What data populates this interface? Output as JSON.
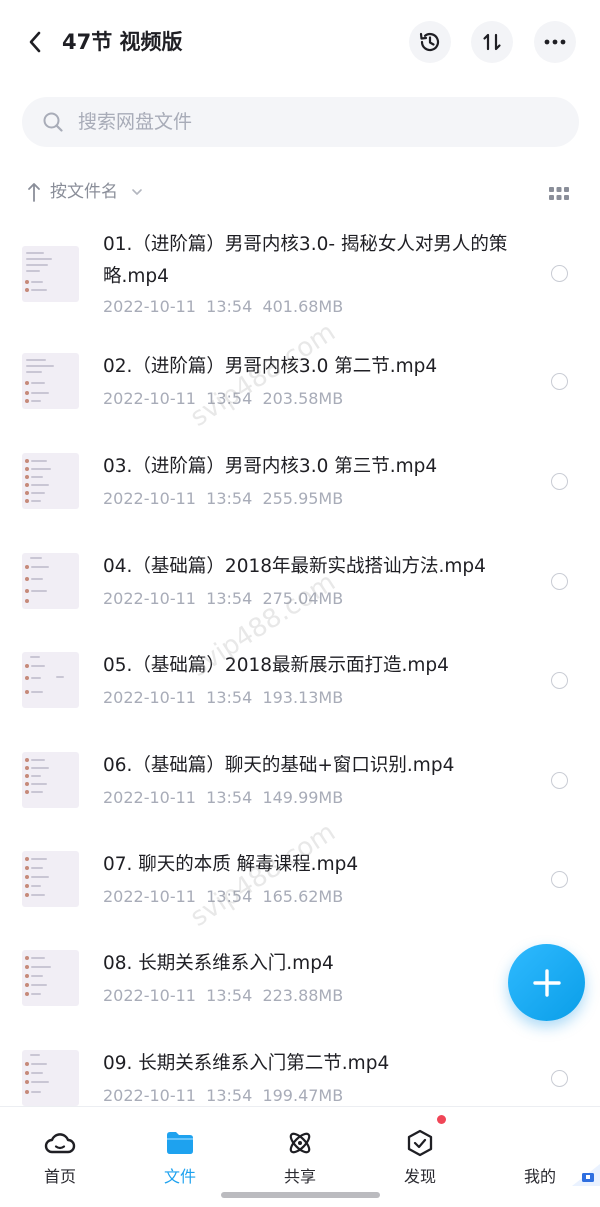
{
  "header": {
    "title": "47节 视频版",
    "back_icon": "chevron-left-icon",
    "history_icon": "history-icon",
    "sort_toggle_icon": "sort-arrows-icon",
    "more_icon": "more-dots-icon"
  },
  "search": {
    "placeholder": "搜索网盘文件",
    "value": ""
  },
  "sort": {
    "label": "按文件名",
    "direction_icon": "arrow-up-icon",
    "caret_icon": "chevron-down-icon",
    "view_icon": "grid-icon"
  },
  "files": [
    {
      "name": "01.（进阶篇）男哥内核3.0- 揭秘女人对男人的策略.mp4",
      "date": "2022-10-11",
      "time": "13:54",
      "size": "401.68MB"
    },
    {
      "name": "02.（进阶篇）男哥内核3.0 第二节.mp4",
      "date": "2022-10-11",
      "time": "13:54",
      "size": "203.58MB"
    },
    {
      "name": "03.（进阶篇）男哥内核3.0 第三节.mp4",
      "date": "2022-10-11",
      "time": "13:54",
      "size": "255.95MB"
    },
    {
      "name": "04.（基础篇）2018年最新实战搭讪方法.mp4",
      "date": "2022-10-11",
      "time": "13:54",
      "size": "275.04MB"
    },
    {
      "name": "05.（基础篇）2018最新展示面打造.mp4",
      "date": "2022-10-11",
      "time": "13:54",
      "size": "193.13MB"
    },
    {
      "name": "06.（基础篇）聊天的基础+窗口识别.mp4",
      "date": "2022-10-11",
      "time": "13:54",
      "size": "149.99MB"
    },
    {
      "name": "07. 聊天的本质 解毒课程.mp4",
      "date": "2022-10-11",
      "time": "13:54",
      "size": "165.62MB"
    },
    {
      "name": "08. 长期关系维系入门.mp4",
      "date": "2022-10-11",
      "time": "13:54",
      "size": "223.88MB"
    },
    {
      "name": "09. 长期关系维系入门第二节.mp4",
      "date": "2022-10-11",
      "time": "13:54",
      "size": "199.47MB"
    }
  ],
  "fab": {
    "icon": "plus-icon"
  },
  "watermarks": [
    "svip488.com",
    "svip488.com",
    "svip488.com"
  ],
  "tabbar": {
    "items": [
      {
        "label": "首页",
        "icon": "cloud-home-icon"
      },
      {
        "label": "文件",
        "icon": "folder-icon"
      },
      {
        "label": "共享",
        "icon": "atom-share-icon"
      },
      {
        "label": "发现",
        "icon": "discover-box-icon"
      },
      {
        "label": "我的",
        "icon": "profile-icon"
      }
    ],
    "active": "文件"
  },
  "colors": {
    "accent": "#1ea2ef",
    "text": "#1f1f24",
    "muted": "#a8acb8",
    "badge": "#f04657"
  }
}
